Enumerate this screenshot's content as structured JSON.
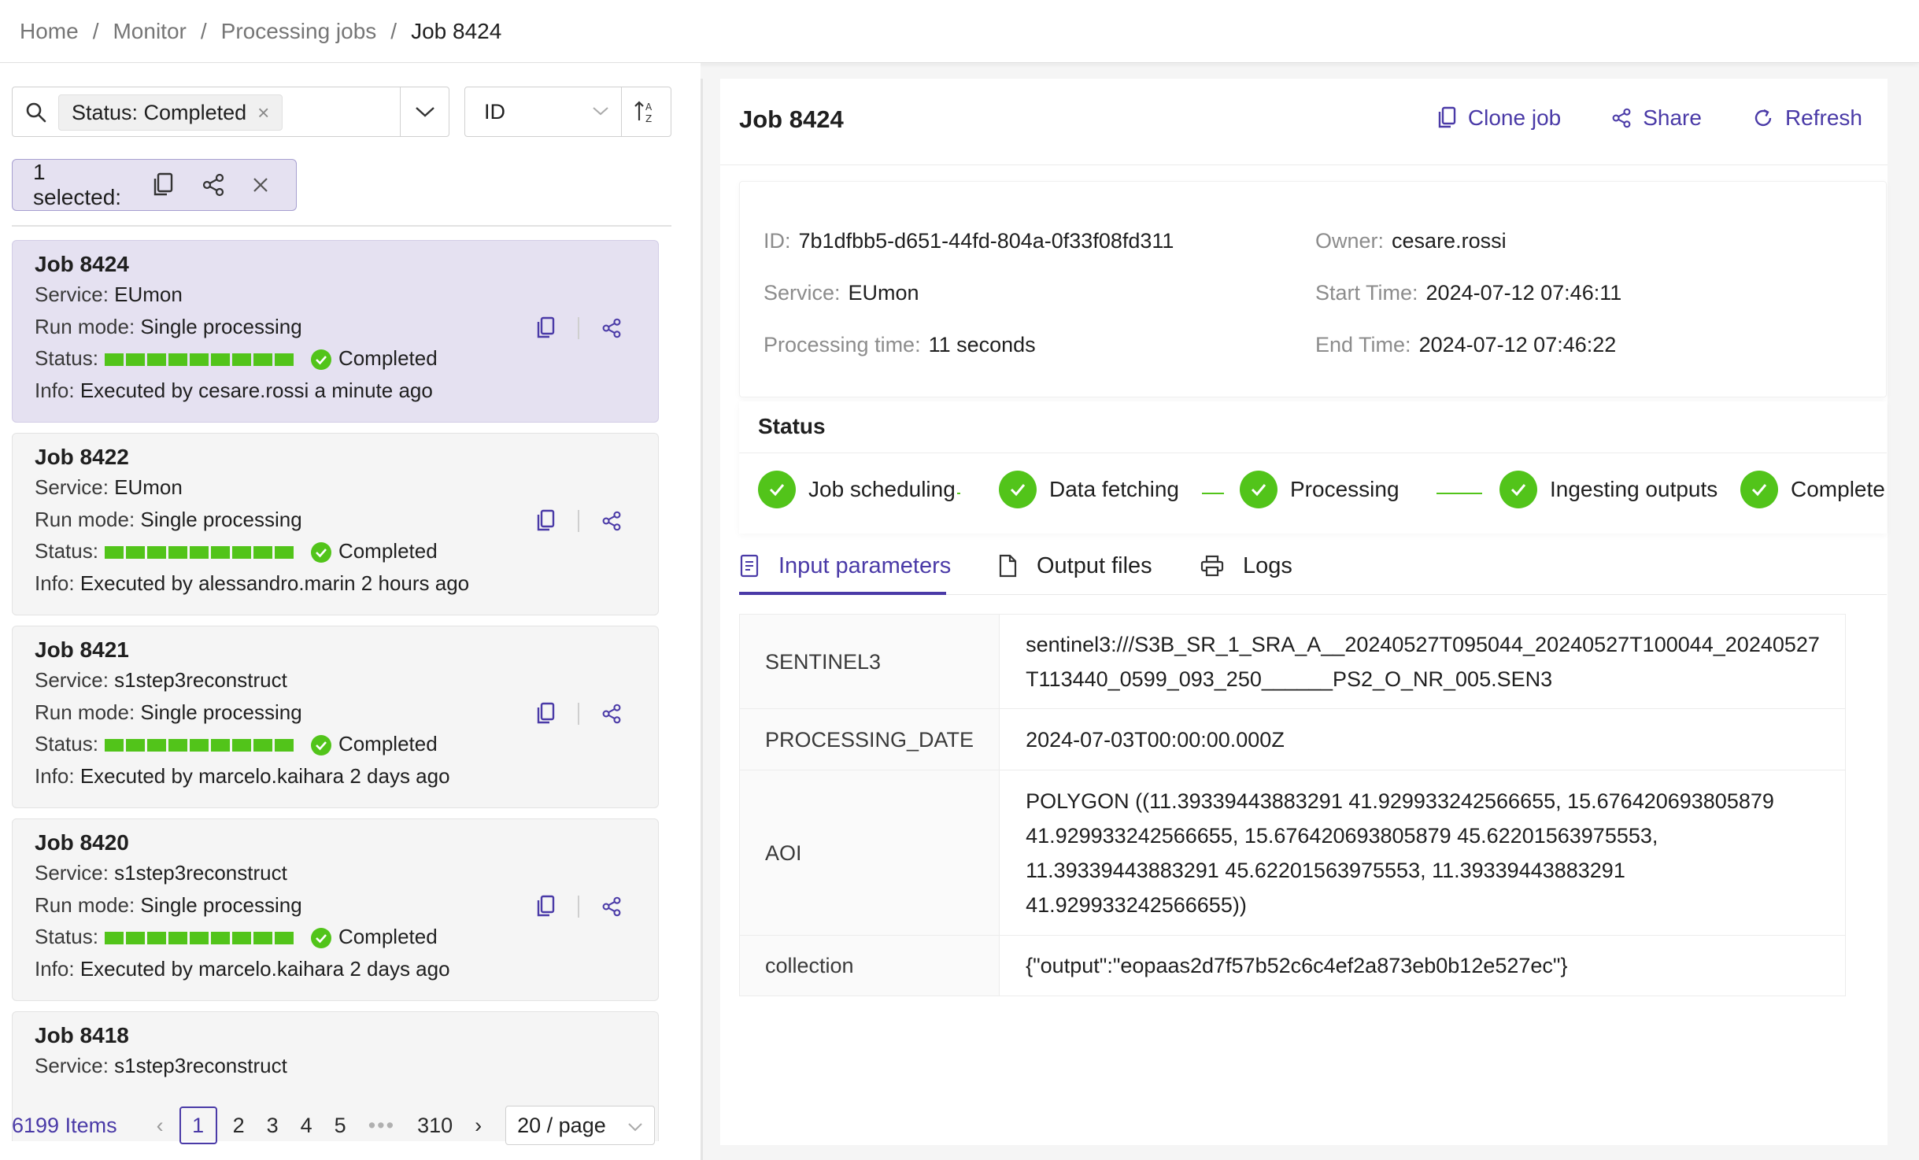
{
  "breadcrumb": [
    "Home",
    "Monitor",
    "Processing jobs",
    "Job 8424"
  ],
  "filter": {
    "tag": "Status: Completed",
    "sort_field": "ID"
  },
  "selection": {
    "label": "1 selected:"
  },
  "labels": {
    "service": "Service:",
    "run_mode": "Run mode:",
    "status": "Status:",
    "info": "Info:"
  },
  "jobs": [
    {
      "title": "Job 8424",
      "service": "EUmon",
      "run_mode": "Single processing",
      "status": "Completed",
      "info": "Executed by cesare.rossi a minute ago",
      "progress_segments": 9
    },
    {
      "title": "Job 8422",
      "service": "EUmon",
      "run_mode": "Single processing",
      "status": "Completed",
      "info": "Executed by alessandro.marin 2 hours ago",
      "progress_segments": 9
    },
    {
      "title": "Job 8421",
      "service": "s1step3reconstruct",
      "run_mode": "Single processing",
      "status": "Completed",
      "info": "Executed by marcelo.kaihara 2 days ago",
      "progress_segments": 9
    },
    {
      "title": "Job 8420",
      "service": "s1step3reconstruct",
      "run_mode": "Single processing",
      "status": "Completed",
      "info": "Executed by marcelo.kaihara 2 days ago",
      "progress_segments": 9
    },
    {
      "title": "Job 8418",
      "service": "s1step3reconstruct"
    }
  ],
  "pagination": {
    "total": "6199 Items",
    "pages": [
      "1",
      "2",
      "3",
      "4",
      "5"
    ],
    "ellipsis": "•••",
    "last": "310",
    "per_page": "20 / page"
  },
  "detail": {
    "title": "Job 8424",
    "actions": {
      "clone": "Clone job",
      "share": "Share",
      "refresh": "Refresh"
    },
    "info": {
      "id_label": "ID:",
      "id": "7b1dfbb5-d651-44fd-804a-0f33f08fd311",
      "owner_label": "Owner:",
      "owner": "cesare.rossi",
      "service_label": "Service:",
      "service": "EUmon",
      "start_label": "Start Time:",
      "start": "2024-07-12 07:46:11",
      "ptime_label": "Processing time:",
      "ptime": "11 seconds",
      "end_label": "End Time:",
      "end": "2024-07-12 07:46:22"
    },
    "status_title": "Status",
    "steps": [
      "Job scheduling",
      "Data fetching",
      "Processing",
      "Ingesting outputs",
      "Complete"
    ],
    "tabs": [
      "Input parameters",
      "Output files",
      "Logs"
    ],
    "params": [
      {
        "key": "SENTINEL3",
        "value": "sentinel3:///S3B_SR_1_SRA_A__20240527T095044_20240527T100044_20240527T113440_0599_093_250______PS2_O_NR_005.SEN3"
      },
      {
        "key": "PROCESSING_DATE",
        "value": "2024-07-03T00:00:00.000Z"
      },
      {
        "key": "AOI",
        "value": "POLYGON ((11.39339443883291 41.929933242566655, 15.676420693805879 41.929933242566655, 15.676420693805879 45.62201563975553, 11.39339443883291 45.62201563975553, 11.39339443883291 41.929933242566655))"
      },
      {
        "key": "collection",
        "value": "{\"output\":\"eopaas2d7f57b52c6c4ef2a873eb0b12e527ec\"}"
      }
    ]
  },
  "colors": {
    "accent": "#4a3aa7",
    "success": "#52c41a",
    "selected_bg": "#e5e1f1"
  }
}
